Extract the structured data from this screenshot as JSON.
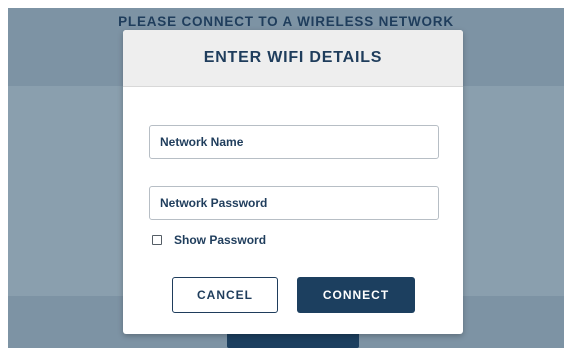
{
  "banner": {
    "text": "PLEASE CONNECT TO A WIRELESS NETWORK"
  },
  "dialog": {
    "title": "ENTER WIFI DETAILS",
    "network_name": {
      "placeholder": "Network Name",
      "value": ""
    },
    "network_password": {
      "placeholder": "Network Password",
      "value": ""
    },
    "show_password": {
      "label": "Show Password",
      "checked": false
    },
    "cancel_label": "CANCEL",
    "connect_label": "CONNECT"
  },
  "colors": {
    "primary": "#1c3f5f",
    "text": "#1f3d5c",
    "background": "#8a9fae",
    "header_bg": "#eeeeee"
  }
}
